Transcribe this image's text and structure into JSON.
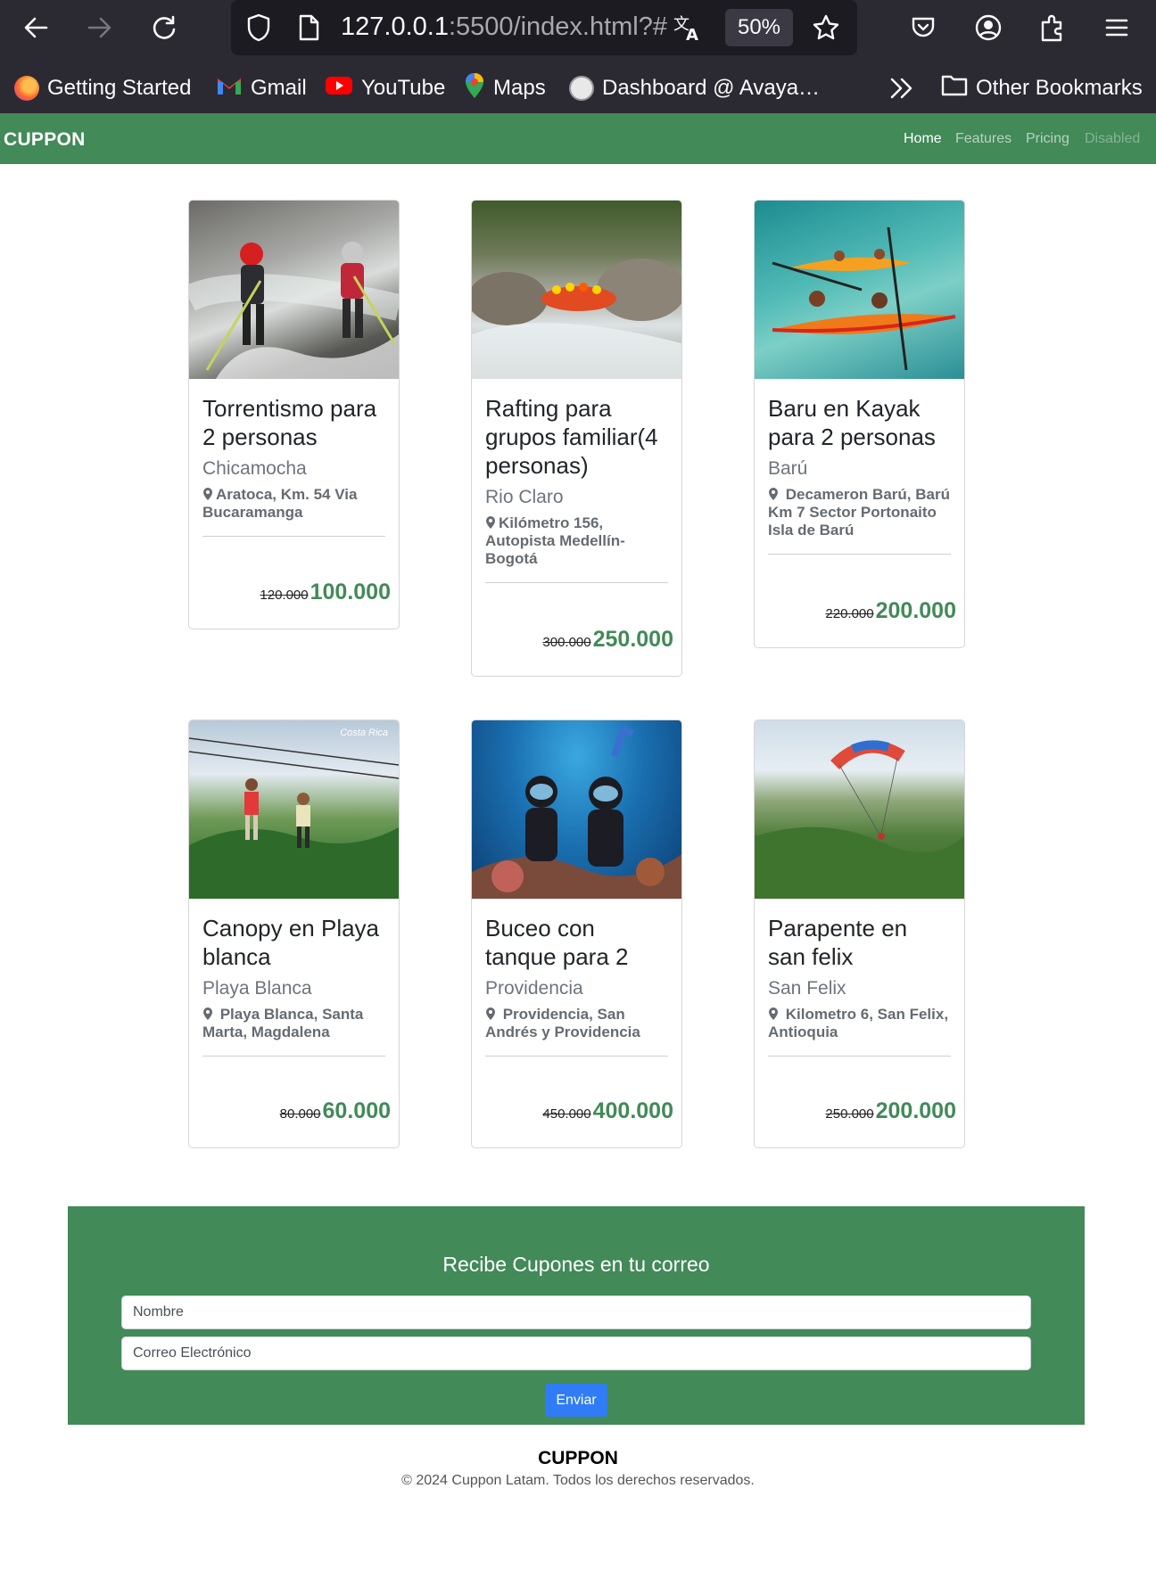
{
  "browser": {
    "url_host": "127.0.0.1",
    "url_rest": ":5500/index.html?#",
    "zoom": "50%",
    "bookmarks": [
      {
        "label": "Getting Started",
        "icon": "firefox-icon"
      },
      {
        "label": "Gmail",
        "icon": "gmail-icon"
      },
      {
        "label": "YouTube",
        "icon": "youtube-icon"
      },
      {
        "label": "Maps",
        "icon": "maps-icon"
      },
      {
        "label": "Dashboard @ Avaya…",
        "icon": "avaya-icon"
      }
    ],
    "other_bookmarks": "Other Bookmarks"
  },
  "navbar": {
    "brand": "CUPPON",
    "links": [
      "Home",
      "Features",
      "Pricing",
      "Disabled"
    ]
  },
  "cards": [
    {
      "title": "Torrentismo para 2 personas",
      "subtitle": "Chicamocha",
      "location": "Aratoca, Km. 54 Via Bucaramanga",
      "old_price": "120.000",
      "price": "100.000",
      "image": "waterfall-rappelling-photo"
    },
    {
      "title": "Rafting para grupos familiar(4 personas)",
      "subtitle": "Rio Claro",
      "location": "Kilómetro 156, Autopista Medellín-Bogotá",
      "old_price": "300.000",
      "price": "250.000",
      "image": "river-rafting-photo"
    },
    {
      "title": "Baru en Kayak para 2 personas",
      "subtitle": "Barú",
      "location": " Decameron Barú, Barú Km 7 Sector Portonaito Isla de Barú",
      "old_price": "220.000",
      "price": "200.000",
      "image": "kayak-photo"
    },
    {
      "title": "Canopy en Playa blanca",
      "subtitle": "Playa Blanca",
      "location": " Playa Blanca, Santa Marta, Magdalena",
      "old_price": "80.000",
      "price": "60.000",
      "image": "zipline-photo",
      "image_caption": "Costa Rica"
    },
    {
      "title": "Buceo con tanque para 2",
      "subtitle": "Providencia",
      "location": " Providencia, San Andrés y Providencia",
      "old_price": "450.000",
      "price": "400.000",
      "image": "scuba-diving-photo"
    },
    {
      "title": "Parapente en san felix",
      "subtitle": "San Felix",
      "location": " Kilometro 6, San Felix, Antioquia",
      "old_price": "250.000",
      "price": "200.000",
      "image": "paragliding-photo"
    }
  ],
  "newsletter": {
    "title": "Recibe Cupones en tu correo",
    "name_placeholder": "Nombre",
    "email_placeholder": "Correo Electrónico",
    "submit_label": "Enviar"
  },
  "footer": {
    "brand": "CUPPON",
    "copyright": "© 2024 Cuppon Latam. Todos los derechos reservados."
  },
  "colors": {
    "brand_green": "#428a58",
    "button_blue": "#2f7cf6",
    "chrome_bg": "#2b2a33"
  }
}
